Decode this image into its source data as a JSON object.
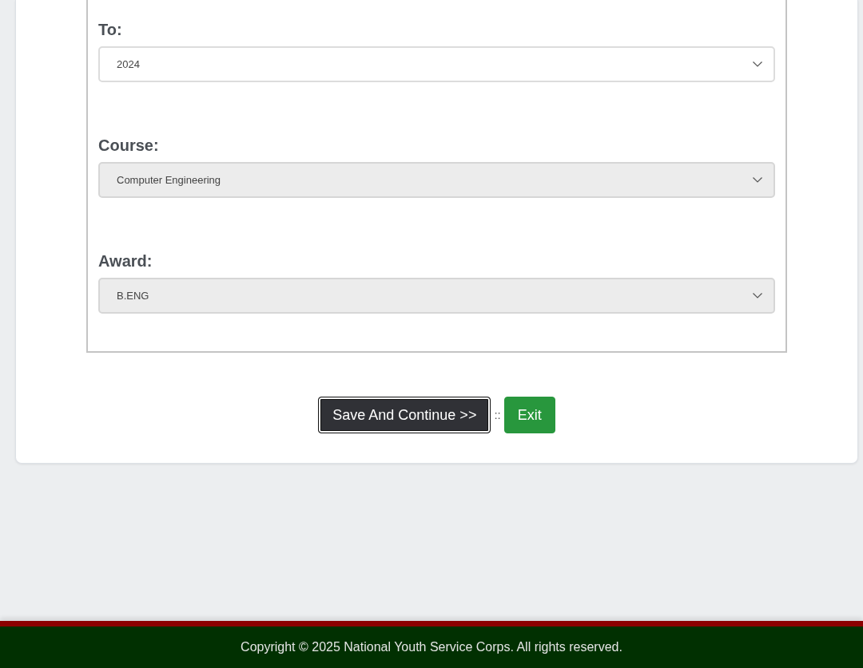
{
  "form": {
    "fields": [
      {
        "label": "To:",
        "value": "2024",
        "disabled": false
      },
      {
        "label": "Course:",
        "value": "Computer Engineering",
        "disabled": true
      },
      {
        "label": "Award:",
        "value": "B.ENG",
        "disabled": true
      }
    ]
  },
  "actions": {
    "buttons": [
      {
        "label": "Save And Continue >>",
        "kind": "dark",
        "focused": true
      },
      {
        "label": "Exit",
        "kind": "success",
        "focused": false
      }
    ],
    "separator": "::"
  },
  "footer": {
    "text": "Copyright © 2025 National Youth Service Corps. All rights reserved."
  }
}
